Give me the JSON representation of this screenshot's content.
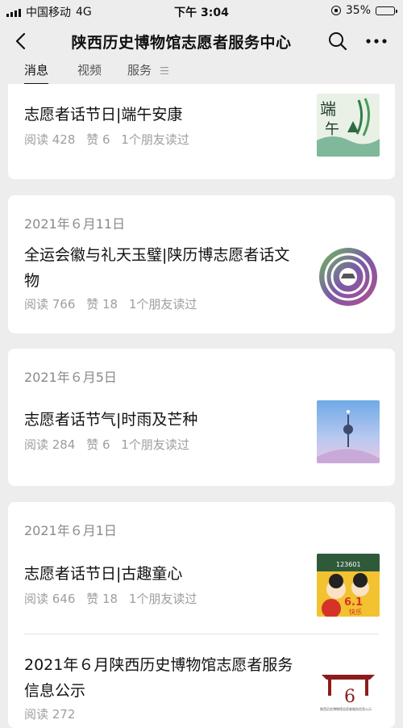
{
  "status_bar": {
    "carrier": "中国移动",
    "network": "4G",
    "time": "下午 3:04",
    "battery": "35%"
  },
  "header": {
    "title": "陕西历史博物馆志愿者服务中心"
  },
  "tabs": [
    "消息",
    "视频",
    "服务"
  ],
  "icons": {
    "back": "chevron-left-icon",
    "search": "search-icon",
    "more": "more-dots-icon",
    "menu": "menu-lines-icon",
    "signal": "signal-bars-icon",
    "lock": "rotation-lock-icon",
    "battery": "battery-icon"
  },
  "articles": [
    {
      "title": "志愿者话节日|端午安康",
      "reads": "阅读 428",
      "likes": "赞 6",
      "friends": "1个朋友读过"
    },
    {
      "date": "2021年６月11日",
      "title": "全运会徽与礼天玉璧|陕历博志愿者话文物",
      "reads": "阅读 766",
      "likes": "赞 18",
      "friends": "1个朋友读过"
    },
    {
      "date": "2021年６月5日",
      "title": "志愿者话节气|时雨及芒种",
      "reads": "阅读 284",
      "likes": "赞 6",
      "friends": "1个朋友读过"
    },
    {
      "date": "2021年６月1日",
      "title": "志愿者话节日|古趣童心",
      "reads": "阅读 646",
      "likes": "赞 18",
      "friends": "1个朋友读过"
    },
    {
      "title": "2021年６月陕西历史博物馆志愿者服务信息公示",
      "reads": "阅读 272"
    }
  ],
  "thumbnails": {
    "duanwu_char1": "端",
    "duanwu_char2": "午",
    "children_day_label": "6.1",
    "children_day_tag": "快乐",
    "children_day_banner": "123601",
    "notice_number": "6",
    "notice_caption": "陕西历史博物馆志愿者服务信息公示"
  },
  "colors": {
    "background": "#ededed",
    "card": "#ffffff",
    "meta": "#9e9e9e",
    "date": "#8a8a8a"
  }
}
